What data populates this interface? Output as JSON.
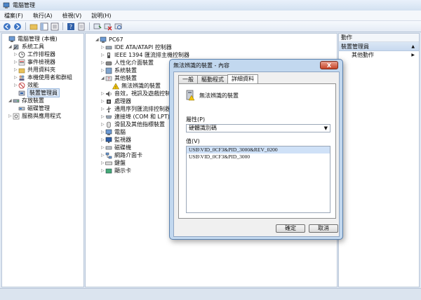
{
  "window": {
    "title": "電腦管理"
  },
  "menu": [
    "檔案(F)",
    "執行(A)",
    "檢視(V)",
    "說明(H)"
  ],
  "left_tree": [
    {
      "label": "電腦管理 (本機)",
      "icon": "computer-icon",
      "level": 0,
      "toggle": ""
    },
    {
      "label": "系統工具",
      "icon": "tools-icon",
      "level": 1,
      "toggle": "◢"
    },
    {
      "label": "工作排程器",
      "icon": "clock-icon",
      "level": 2,
      "toggle": "▷"
    },
    {
      "label": "事件檢視器",
      "icon": "event-icon",
      "level": 2,
      "toggle": "▷"
    },
    {
      "label": "共用資料夾",
      "icon": "folder-icon",
      "level": 2,
      "toggle": "▷"
    },
    {
      "label": "本機使用者和群組",
      "icon": "users-icon",
      "level": 2,
      "toggle": "▷"
    },
    {
      "label": "效能",
      "icon": "perf-icon",
      "level": 2,
      "toggle": "▷"
    },
    {
      "label": "裝置管理員",
      "icon": "device-icon",
      "level": 2,
      "toggle": "",
      "selected": true
    },
    {
      "label": "存放裝置",
      "icon": "storage-icon",
      "level": 1,
      "toggle": "◢"
    },
    {
      "label": "磁碟管理",
      "icon": "disk-icon",
      "level": 2,
      "toggle": ""
    },
    {
      "label": "服務與應用程式",
      "icon": "services-icon",
      "level": 1,
      "toggle": "▷"
    }
  ],
  "device_tree": [
    {
      "label": "PC67",
      "icon": "computer-icon",
      "level": 0,
      "toggle": "◢"
    },
    {
      "label": "IDE ATA/ATAPI 控制器",
      "icon": "ide-icon",
      "level": 1,
      "toggle": "▷"
    },
    {
      "label": "IEEE 1394 匯流排主機控制器",
      "icon": "ieee-icon",
      "level": 1,
      "toggle": "▷"
    },
    {
      "label": "人性化介面裝置",
      "icon": "hid-icon",
      "level": 1,
      "toggle": "▷"
    },
    {
      "label": "系統裝置",
      "icon": "system-icon",
      "level": 1,
      "toggle": "▷"
    },
    {
      "label": "其他裝置",
      "icon": "other-icon",
      "level": 1,
      "toggle": "◢"
    },
    {
      "label": "無法辨識的裝置",
      "icon": "warning-icon",
      "level": 2,
      "toggle": ""
    },
    {
      "label": "音效，視訊及遊戲控制器",
      "icon": "sound-icon",
      "level": 1,
      "toggle": "▷"
    },
    {
      "label": "處理器",
      "icon": "cpu-icon",
      "level": 1,
      "toggle": "▷"
    },
    {
      "label": "通用序列匯流排控制器",
      "icon": "usb-icon",
      "level": 1,
      "toggle": "▷"
    },
    {
      "label": "連接埠 (COM 和 LPT)",
      "icon": "port-icon",
      "level": 1,
      "toggle": "▷"
    },
    {
      "label": "滑鼠及其他指標裝置",
      "icon": "mouse-icon",
      "level": 1,
      "toggle": "▷"
    },
    {
      "label": "電腦",
      "icon": "computer-icon",
      "level": 1,
      "toggle": "▷"
    },
    {
      "label": "監視器",
      "icon": "monitor-icon",
      "level": 1,
      "toggle": "▷"
    },
    {
      "label": "磁碟機",
      "icon": "disk-icon",
      "level": 1,
      "toggle": "▷"
    },
    {
      "label": "網路介面卡",
      "icon": "network-icon",
      "level": 1,
      "toggle": "▷"
    },
    {
      "label": "鍵盤",
      "icon": "keyboard-icon",
      "level": 1,
      "toggle": "▷"
    },
    {
      "label": "顯示卡",
      "icon": "display-icon",
      "level": 1,
      "toggle": "▷"
    }
  ],
  "actions": {
    "header": "動作",
    "section": "裝置管理員",
    "section_arrow": "▲",
    "more": "其他動作",
    "more_arrow": "▶"
  },
  "dialog": {
    "title": "無法辨識的裝置 - 內容",
    "close": "X",
    "tabs": [
      "一般",
      "驅動程式",
      "詳細資料"
    ],
    "active_tab": 2,
    "device_name": "無法辨識的裝置",
    "property_label": "屬性(P)",
    "property_value": "硬體識別碼",
    "value_label": "值(V)",
    "values": [
      "USB\\VID_0CF3&PID_3000&REV_0200",
      "USB\\VID_0CF3&PID_3000"
    ],
    "ok": "確定",
    "cancel": "取消"
  },
  "colors": {
    "accent": "#3c74c4",
    "selection": "#cfe1f7"
  }
}
